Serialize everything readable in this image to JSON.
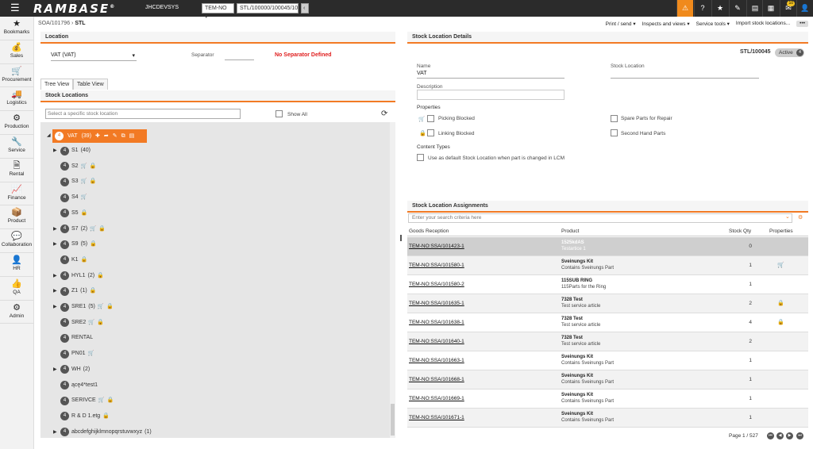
{
  "topbar": {
    "logo": "RAMBASE",
    "logo_mark": "®",
    "system_name": "JHCDEVSYS",
    "company_select": "TEM-NO",
    "object_field": "STL/100000/100045/10",
    "mail_count": "10"
  },
  "sidebar": {
    "items": [
      {
        "label": "Bookmarks",
        "icon": "★"
      },
      {
        "label": "Sales",
        "icon": "💰"
      },
      {
        "label": "Procurement",
        "icon": "🛒"
      },
      {
        "label": "Logistics",
        "icon": "🚚"
      },
      {
        "label": "Production",
        "icon": "⚙"
      },
      {
        "label": "Service",
        "icon": "🔧"
      },
      {
        "label": "Rental",
        "icon": "🗎"
      },
      {
        "label": "Finance",
        "icon": "📈"
      },
      {
        "label": "Product",
        "icon": "📦"
      },
      {
        "label": "Collaboration",
        "icon": "💬"
      },
      {
        "label": "HR",
        "icon": "👤"
      },
      {
        "label": "QA",
        "icon": "👍"
      },
      {
        "label": "Admin",
        "icon": "⚙"
      }
    ]
  },
  "breadcrumb": {
    "path": "SOA/101796",
    "sep": "›",
    "current": "STL"
  },
  "actions": [
    "Print / send ▾",
    "Inspects and views ▾",
    "Service tools ▾",
    "Import stock locations...",
    "•••"
  ],
  "location": {
    "header": "Location",
    "value": "VAT (VAT)",
    "separator_label": "Separator",
    "separator_warning": "No Separator Defined"
  },
  "tabs": {
    "tree": "Tree View",
    "table": "Table View"
  },
  "stock_locations": {
    "header": "Stock Locations",
    "search_placeholder": "Select a specific stock location",
    "show_all": "Show All",
    "root": {
      "name": "VAT",
      "count": "(39)"
    },
    "nodes": [
      {
        "name": "S1",
        "count": "(40)",
        "expand": true,
        "cart": false,
        "lock": false
      },
      {
        "name": "S2",
        "count": "",
        "expand": false,
        "cart": true,
        "lock": true
      },
      {
        "name": "S3",
        "count": "",
        "expand": false,
        "cart": true,
        "lock": true
      },
      {
        "name": "S4",
        "count": "",
        "expand": false,
        "cart": true,
        "lock": false
      },
      {
        "name": "S5",
        "count": "",
        "expand": false,
        "cart": false,
        "lock": true
      },
      {
        "name": "S7",
        "count": "(2)",
        "expand": true,
        "cart": true,
        "lock": true
      },
      {
        "name": "S9",
        "count": "(5)",
        "expand": true,
        "cart": false,
        "lock": true
      },
      {
        "name": "K1",
        "count": "",
        "expand": false,
        "cart": false,
        "lock": true
      },
      {
        "name": "HYL1",
        "count": "(2)",
        "expand": true,
        "cart": false,
        "lock": true
      },
      {
        "name": "Z1",
        "count": "(1)",
        "expand": true,
        "cart": false,
        "lock": true
      },
      {
        "name": "SRE1",
        "count": "(5)",
        "expand": true,
        "cart": true,
        "lock": true
      },
      {
        "name": "SRE2",
        "count": "",
        "expand": false,
        "cart": true,
        "lock": true
      },
      {
        "name": "RENTAL",
        "count": "",
        "expand": false,
        "cart": false,
        "lock": false
      },
      {
        "name": "PN01",
        "count": "",
        "expand": false,
        "cart": true,
        "lock": false
      },
      {
        "name": "WH",
        "count": "(2)",
        "expand": true,
        "cart": false,
        "lock": false
      },
      {
        "name": "ącę4*test1",
        "count": "",
        "expand": false,
        "cart": false,
        "lock": false
      },
      {
        "name": "SERIVCE",
        "count": "",
        "expand": false,
        "cart": true,
        "lock": true
      },
      {
        "name": "R & D 1.etg",
        "count": "",
        "expand": false,
        "cart": false,
        "lock": true
      },
      {
        "name": "abcdefghijklmnopqrstuvwxyz",
        "count": "(1)",
        "expand": true,
        "cart": false,
        "lock": false
      }
    ]
  },
  "details": {
    "header": "Stock Location Details",
    "id": "STL/100045",
    "status": "Active",
    "status_num": "4",
    "name_label": "Name",
    "name_value": "VAT",
    "stock_location_label": "Stock Location",
    "description_label": "Description",
    "properties_label": "Properties",
    "picking_blocked": "Picking Blocked",
    "linking_blocked": "Linking Blocked",
    "spare_parts": "Spare Parts for Repair",
    "second_hand": "Second Hand Parts",
    "content_types_label": "Content Types",
    "default_lcm": "Use as default Stock Location when part is changed in LCM"
  },
  "assignments": {
    "header": "Stock Location Assignments",
    "search_placeholder": "Enter your search criteria here",
    "columns": [
      "Goods Reception",
      "Product",
      "Stock Qty",
      "Properties"
    ],
    "rows": [
      {
        "gr": "TEM-NO:SSA/101423-1",
        "p1": "1525kdAS",
        "p2": "Testartice 1",
        "qty": "0",
        "prop": ""
      },
      {
        "gr": "TEM-NO:SSA/101580-1",
        "p1": "Sveinungs Kit",
        "p2": "Contains Sveinungs Part",
        "qty": "1",
        "prop": "cart"
      },
      {
        "gr": "TEM-NO:SSA/101580-2",
        "p1": "115SUB RING",
        "p2": "115Parts for the Ring",
        "qty": "1",
        "prop": ""
      },
      {
        "gr": "TEM-NO:SSA/101635-1",
        "p1": "7328 Test",
        "p2": "Test service article",
        "qty": "2",
        "prop": "lock"
      },
      {
        "gr": "TEM-NO:SSA/101638-1",
        "p1": "7328 Test",
        "p2": "Test service article",
        "qty": "4",
        "prop": "lock"
      },
      {
        "gr": "TEM-NO:SSA/101640-1",
        "p1": "7328 Test",
        "p2": "Test service article",
        "qty": "2",
        "prop": ""
      },
      {
        "gr": "TEM-NO:SSA/101663-1",
        "p1": "Sveinungs Kit",
        "p2": "Contains Sveinungs Part",
        "qty": "1",
        "prop": ""
      },
      {
        "gr": "TEM-NO:SSA/101668-1",
        "p1": "Sveinungs Kit",
        "p2": "Contains Sveinungs Part",
        "qty": "1",
        "prop": ""
      },
      {
        "gr": "TEM-NO:SSA/101669-1",
        "p1": "Sveinungs Kit",
        "p2": "Contains Sveinungs Part",
        "qty": "1",
        "prop": ""
      },
      {
        "gr": "TEM-NO:SSA/101671-1",
        "p1": "Sveinungs Kit",
        "p2": "Contains Sveinungs Part",
        "qty": "1",
        "prop": ""
      }
    ],
    "pager": "Page 1 / 527"
  },
  "colors": {
    "accent": "#f27a24",
    "topbar": "#2b2b2b"
  }
}
